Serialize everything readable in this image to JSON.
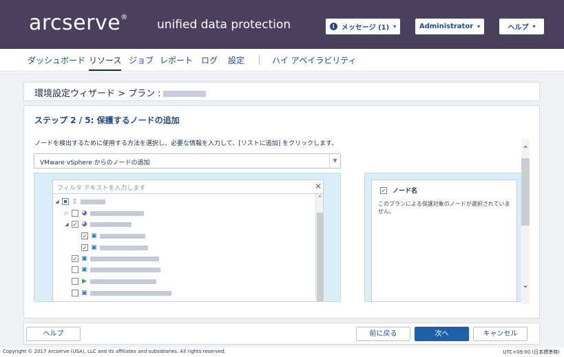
{
  "header": {
    "logo": "arcserve",
    "logo_reg": "®",
    "product": "unified data protection",
    "messages_label": "メッセージ (1)",
    "admin_label": "Administrator",
    "help_label": "ヘルプ",
    "caret": "▾",
    "info_glyph": "i"
  },
  "nav": {
    "items": [
      "ダッシュボード",
      "リソース",
      "ジョブ",
      "レポート",
      "ログ",
      "設定",
      "ハイ アベイラビリティ"
    ],
    "active": "リソース"
  },
  "breadcrumb": {
    "text": "環境設定ウィザード > プラン :"
  },
  "wizard": {
    "step_title": "ステップ 2 / 5: 保護するノードの追加",
    "instruction": "ノードを検出するために使用する方法を選択し、必要な情報を入力して、[リストに追加] をクリックします。",
    "method_select": "VMware vSphere からのノードの追加",
    "filter_placeholder": "フィルタ テキストを入力します",
    "clear_glyph": "✕",
    "selected_header": "ノード名",
    "selected_message": "このプランによる保護対象のノードが選択されていません。"
  },
  "footer": {
    "help_label": "ヘルプ",
    "back_label": "前に戻る",
    "next_label": "次へ",
    "cancel_label": "キャンセル"
  },
  "status": {
    "copyright": "Copyright © 2017 Arcserve (USA), LLC and its affiliates and subsidiaries. All rights reserved.",
    "timezone": "UTC+09:00 (日本標準時)"
  },
  "colors": {
    "header_bg": "#4b3f5e",
    "primary": "#1f5fa8",
    "link": "#1f4a8a",
    "pane_bg": "#d9eef6"
  }
}
